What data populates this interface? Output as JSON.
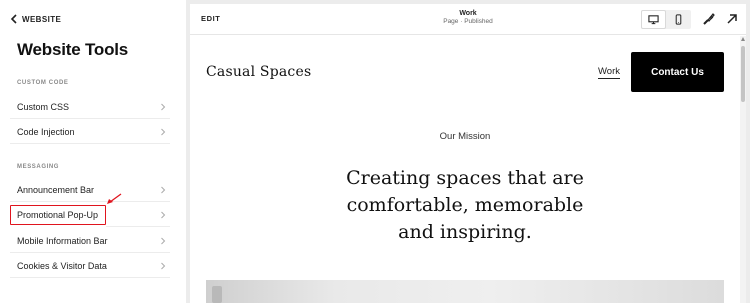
{
  "sidebar": {
    "back_label": "WEBSITE",
    "title": "Website Tools",
    "sections": [
      {
        "label": "CUSTOM CODE"
      },
      {
        "label": "MESSAGING"
      }
    ],
    "items": [
      {
        "label": "Custom CSS"
      },
      {
        "label": "Code Injection"
      },
      {
        "label": "Announcement Bar"
      },
      {
        "label": "Promotional Pop-Up",
        "highlighted": true
      },
      {
        "label": "Mobile Information Bar"
      },
      {
        "label": "Cookies & Visitor Data"
      }
    ],
    "highlight_color": "#e0141e"
  },
  "topbar": {
    "edit_label": "EDIT",
    "page_name": "Work",
    "page_status": "Page · Published",
    "device_mode": "desktop",
    "icons": [
      "desktop-icon",
      "mobile-icon",
      "style-brush-icon",
      "external-link-icon"
    ]
  },
  "site": {
    "logo": "Casual Spaces",
    "nav_link": "Work",
    "cta_label": "Contact Us",
    "mission_label": "Our Mission",
    "headline": "Creating spaces that are comfortable, memorable and inspiring."
  }
}
